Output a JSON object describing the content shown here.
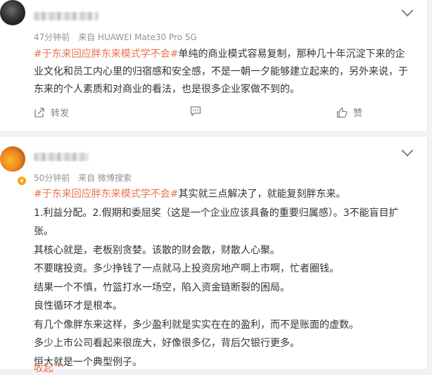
{
  "colors": {
    "topic": "#eb7350",
    "meta": "#939393",
    "text": "#333333",
    "background": "#f2f2f5"
  },
  "posts": [
    {
      "time": "47分钟前",
      "source": "来自 HUAWEI Mate30 Pro 5G",
      "topic": "#于东来回应胖东来模式学不会#",
      "content": "单纯的商业模式容易复制，那种几十年沉淀下来的企业文化和员工内心里的归宿感和安全感，不是一朝一夕能够建立起来的，另外来说，于东来的个人素质和对商业的看法，也是很多企业家做不到的。",
      "actions": {
        "share_label": "转发",
        "comment_label": "",
        "like_label": "赞"
      },
      "icons": [
        "chevron-down-icon",
        "share-icon",
        "comment-icon",
        "like-icon"
      ]
    },
    {
      "time": "50分钟前",
      "source": "来自 微博搜索",
      "verified_badge": "v",
      "topic": "#于东来回应胖东来模式学不会#",
      "first_line_rest": "其实就三点解决了，就能复刻胖东来。",
      "paragraphs": [
        "1.利益分配。2.假期和委屈奖（这是一个企业应该具备的重要归属感）。3不能盲目扩张。",
        "其核心就是，老板别贪婪。该散的财会散，财散人心聚。",
        "不要瞎投资。多少挣钱了一点就马上投资房地产啊上市啊，忙者圈钱。",
        "结果一个不慎，竹篮打水一场空，陷入资金链断裂的困局。",
        "良性循环才是根本。",
        "有几个像胖东来这样，多少盈利就是实实在在的盈利，而不是账面的虚数。",
        "多少上市公司看起来很庞大，好像很多亿，背后欠银行更多。",
        "恒大就是一个典型例子。"
      ],
      "expand_label": "收起 ^"
    }
  ]
}
